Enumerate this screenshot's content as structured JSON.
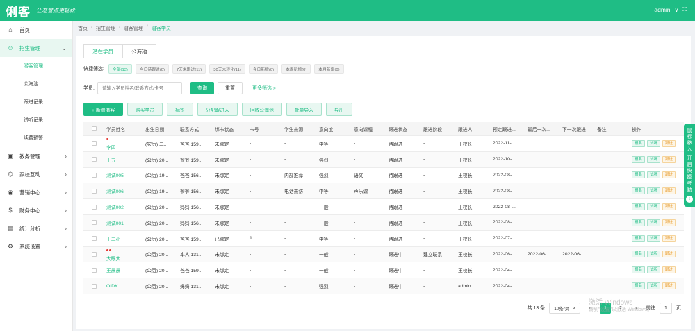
{
  "header": {
    "logo": "俐客",
    "slogan": "让老管点更轻松",
    "user": "admin",
    "user_chevron": "∨",
    "fullscreen_icon": "⛶"
  },
  "sidebar": {
    "items": [
      {
        "icon": "⌂",
        "label": "首页"
      },
      {
        "icon": "☺",
        "label": "招生管理",
        "arrow": "⌄"
      },
      {
        "icon": "▣",
        "label": "教务管理",
        "arrow": "›"
      },
      {
        "icon": "⌬",
        "label": "家校互动",
        "arrow": "›"
      },
      {
        "icon": "◉",
        "label": "营销中心",
        "arrow": "›"
      },
      {
        "icon": "$",
        "label": "财务中心",
        "arrow": "›"
      },
      {
        "icon": "▤",
        "label": "统计分析",
        "arrow": "›"
      },
      {
        "icon": "⚙",
        "label": "系统设置",
        "arrow": "›"
      }
    ],
    "subitems": [
      "潜客管理",
      "公海池",
      "跟进记录",
      "试听记录",
      "续费预警"
    ]
  },
  "breadcrumb": [
    "首页",
    "招生管理",
    "潜客管理",
    "潜客学员"
  ],
  "breadcrumb_sep": "/",
  "tabs": [
    "潜在学员",
    "公海池"
  ],
  "quick_filter": {
    "label": "快捷筛选:",
    "chips": [
      "全部(13)",
      "今日待跟进(0)",
      "7天未跟进(11)",
      "30天未转化(11)",
      "今日新增(0)",
      "本周新增(0)",
      "本月新增(0)"
    ]
  },
  "search": {
    "label": "学员:",
    "placeholder": "请输入学员姓名/联系方式/卡号",
    "query_btn": "查询",
    "reset_btn": "重置",
    "more": "更多筛选 »"
  },
  "actions": [
    "+ 新增潜客",
    "购买学员",
    "标签",
    "分配跟进人",
    "回收公海池",
    "批量导入",
    "导出"
  ],
  "table": {
    "headers": [
      "学员姓名",
      "出生日期",
      "联系方式",
      "绑卡状态",
      "卡号",
      "学生来源",
      "意向度",
      "意向课程",
      "跟进状态",
      "跟进阶段",
      "跟进人",
      "预定跟进...",
      "最后一次...",
      "下一次跟进",
      "备注",
      "操作"
    ],
    "rows": [
      {
        "dots": 1,
        "name": "李四",
        "birth": "(农历) 二...",
        "contact": "爸爸 159...",
        "bind": "未绑定",
        "card": "-",
        "source": "-",
        "intent": "中等",
        "course": "-",
        "status": "待跟进",
        "stage": "-",
        "owner": "王校长",
        "plan": "2022-11-...",
        "last": "",
        "next": "",
        "note": ""
      },
      {
        "dots": 0,
        "name": "王五",
        "birth": "(公历) 20...",
        "contact": "爷爷 159...",
        "bind": "未绑定",
        "card": "-",
        "source": "-",
        "intent": "强烈",
        "course": "-",
        "status": "待跟进",
        "stage": "-",
        "owner": "王校长",
        "plan": "2022-10-...",
        "last": "",
        "next": "",
        "note": ""
      },
      {
        "dots": 0,
        "name": "测试005",
        "birth": "(公历) 19...",
        "contact": "爸爸 156...",
        "bind": "未绑定",
        "card": "-",
        "source": "内部推荐",
        "intent": "强烈",
        "course": "语文",
        "status": "待跟进",
        "stage": "-",
        "owner": "王校长",
        "plan": "2022-08-...",
        "last": "",
        "next": "",
        "note": ""
      },
      {
        "dots": 0,
        "name": "测试006",
        "birth": "(公历) 19...",
        "contact": "爷爷 156...",
        "bind": "未绑定",
        "card": "-",
        "source": "电话来访",
        "intent": "中等",
        "course": "声乐课",
        "status": "待跟进",
        "stage": "-",
        "owner": "王校长",
        "plan": "2022-08-...",
        "last": "",
        "next": "",
        "note": ""
      },
      {
        "dots": 0,
        "name": "测试002",
        "birth": "(公历) 20...",
        "contact": "妈妈 156...",
        "bind": "未绑定",
        "card": "-",
        "source": "-",
        "intent": "一般",
        "course": "-",
        "status": "待跟进",
        "stage": "-",
        "owner": "王校长",
        "plan": "2022-08-...",
        "last": "",
        "next": "",
        "note": ""
      },
      {
        "dots": 0,
        "name": "测试001",
        "birth": "(公历) 20...",
        "contact": "妈妈 156...",
        "bind": "未绑定",
        "card": "-",
        "source": "-",
        "intent": "一般",
        "course": "-",
        "status": "待跟进",
        "stage": "-",
        "owner": "王校长",
        "plan": "2022-08-...",
        "last": "",
        "next": "",
        "note": ""
      },
      {
        "dots": 0,
        "name": "王二小",
        "birth": "(公历) 20...",
        "contact": "爸爸 159...",
        "bind": "已绑定",
        "card": "1",
        "source": "-",
        "intent": "中等",
        "course": "-",
        "status": "待跟进",
        "stage": "-",
        "owner": "王校长",
        "plan": "2022-07-...",
        "last": "",
        "next": "",
        "note": ""
      },
      {
        "dots": 2,
        "name": "大眼大",
        "birth": "(公历) 20...",
        "contact": "本人 131...",
        "bind": "未绑定",
        "card": "-",
        "source": "-",
        "intent": "一般",
        "course": "-",
        "status": "跟进中",
        "stage": "建立联系",
        "owner": "王校长",
        "plan": "2022-06-...",
        "last": "2022-06-...",
        "next": "2022-06-...",
        "note": ""
      },
      {
        "dots": 0,
        "name": "王晨晨",
        "birth": "(公历) 20...",
        "contact": "爸爸 159...",
        "bind": "未绑定",
        "card": "-",
        "source": "-",
        "intent": "一般",
        "course": "-",
        "status": "跟进中",
        "stage": "-",
        "owner": "王校长",
        "plan": "2022-04-...",
        "last": "",
        "next": "",
        "note": ""
      },
      {
        "dots": 0,
        "name": "OIDK",
        "birth": "(公历) 20...",
        "contact": "妈妈 131...",
        "bind": "未绑定",
        "card": "-",
        "source": "-",
        "intent": "强烈",
        "course": "-",
        "status": "跟进中",
        "stage": "-",
        "owner": "admin",
        "plan": "2022-04-...",
        "last": "",
        "next": "",
        "note": ""
      }
    ],
    "ops": [
      "报名",
      "试听",
      "跟进"
    ]
  },
  "pagination": {
    "total": "共 13 条",
    "per_page": "10条/页",
    "prev": "‹",
    "pages": [
      "1",
      "2"
    ],
    "next": "›",
    "goto": "前往",
    "goto_value": "1",
    "page_suffix": "页"
  },
  "watermark": {
    "line1": "激活 Windows",
    "line2": "转到\"设置\"以激活 Windows。"
  },
  "float_tab": {
    "text1": "鼠标移入",
    "text2": "开启快捷考勤",
    "icon": "‹"
  }
}
